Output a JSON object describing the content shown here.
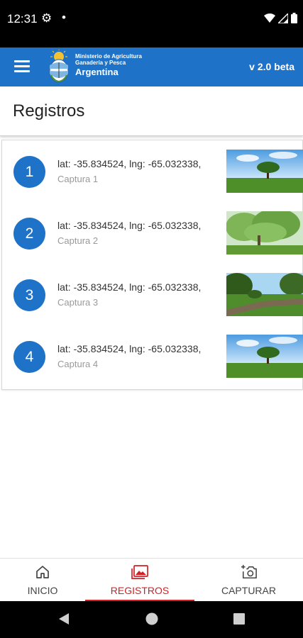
{
  "status_bar": {
    "time": "12:31"
  },
  "app_bar": {
    "logo_line1": "Ministerio de Agricultura",
    "logo_line2": "Ganadería y Pesca",
    "logo_line3": "Argentina",
    "version": "v 2.0 beta"
  },
  "page": {
    "title": "Registros"
  },
  "records": [
    {
      "number": "1",
      "coords": "lat: -35.834524, lng: -65.032338,",
      "caption": "Captura 1"
    },
    {
      "number": "2",
      "coords": "lat: -35.834524, lng: -65.032338,",
      "caption": "Captura 2"
    },
    {
      "number": "3",
      "coords": "lat: -35.834524, lng: -65.032338,",
      "caption": "Captura 3"
    },
    {
      "number": "4",
      "coords": "lat: -35.834524, lng: -65.032338,",
      "caption": "Captura 4"
    }
  ],
  "bottom_nav": {
    "items": [
      {
        "label": "INICIO",
        "icon": "home-icon"
      },
      {
        "label": "REGISTROS",
        "icon": "photos-icon"
      },
      {
        "label": "CAPTURAR",
        "icon": "add-camera-icon"
      }
    ],
    "active_index": 1
  },
  "colors": {
    "primary": "#1e73c8",
    "accent": "#d31f24"
  }
}
